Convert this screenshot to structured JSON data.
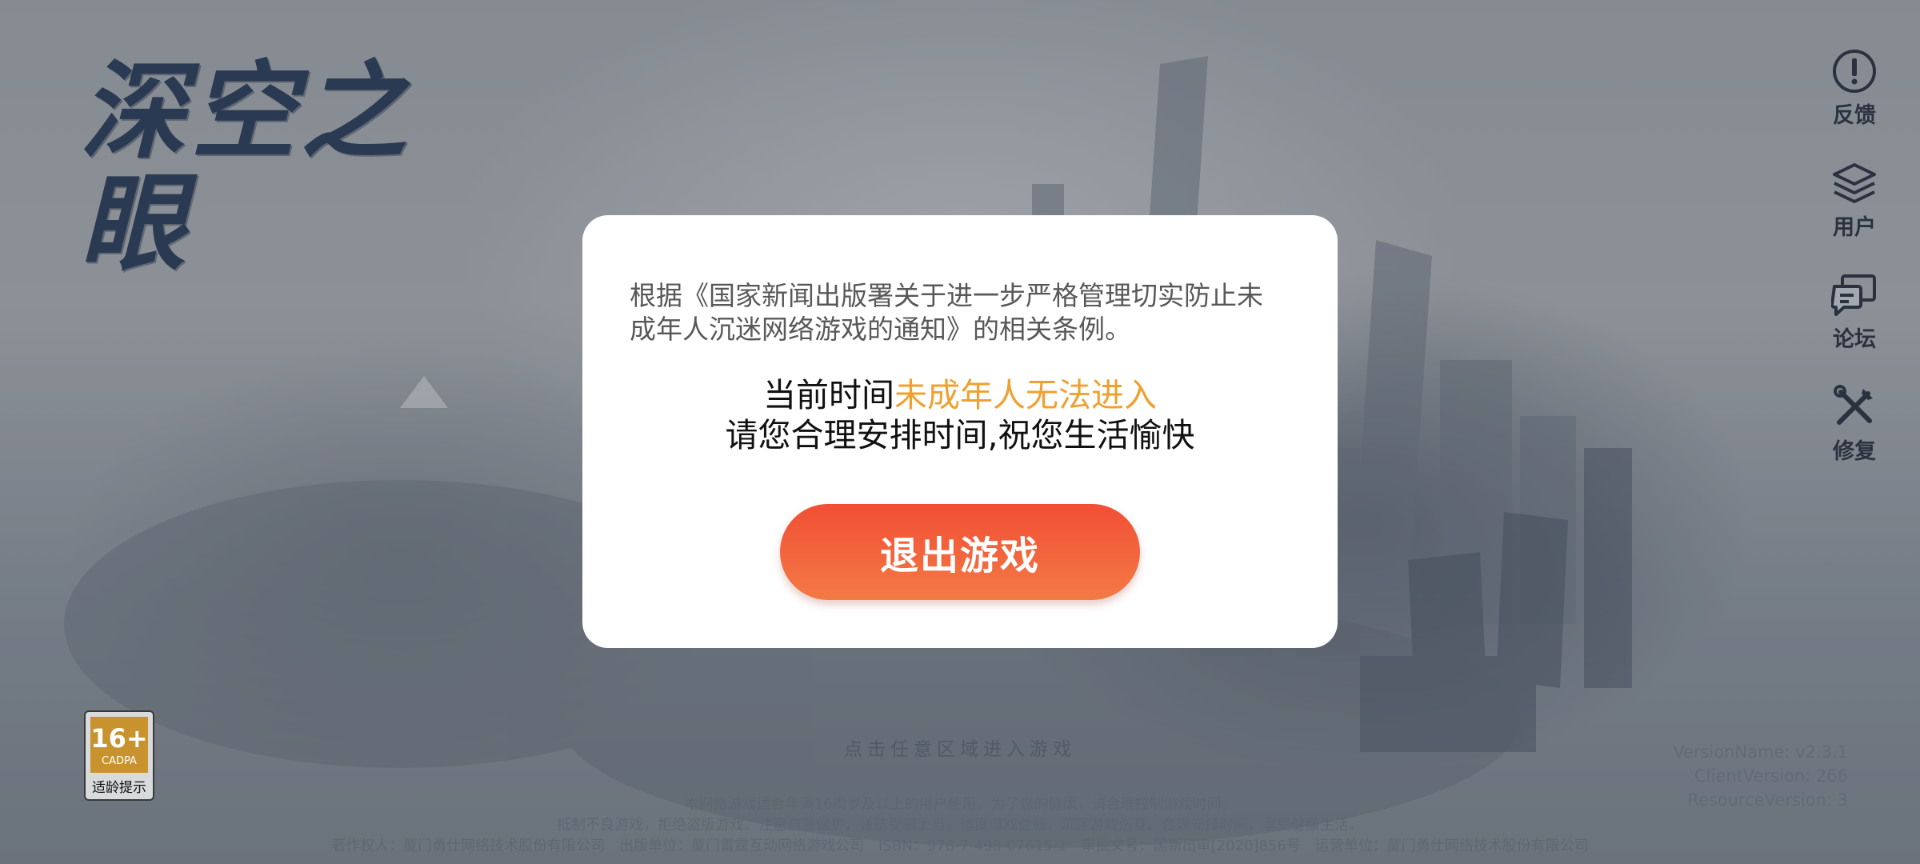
{
  "logo": {
    "text": "深空之眼"
  },
  "side_menu": {
    "items": [
      {
        "label": "反馈",
        "icon": "exclamation-circle-icon"
      },
      {
        "label": "用户",
        "icon": "layers-icon"
      },
      {
        "label": "论坛",
        "icon": "chat-bubbles-icon"
      },
      {
        "label": "修复",
        "icon": "tools-icon"
      }
    ]
  },
  "modal": {
    "notice": "根据《国家新闻出版署关于进一步严格管理切实防止未成年人沉迷网络游戏的通知》的相关条例。",
    "status_prefix": "当前时间",
    "status_highlight": "未成年人无法进入",
    "status_line2": "请您合理安排时间,祝您生活愉快",
    "exit_button": "退出游戏",
    "highlight_color": "#f0a030",
    "button_color": "#f24e35"
  },
  "age_badge": {
    "rating": "16+",
    "org": "CADPA",
    "label": "适龄提示"
  },
  "enter_hint": "点击任意区域进入游戏",
  "footer": {
    "line1": "本网络游戏适合年满16周岁及以上的用户使用。为了您的健康，请合理控制游戏时间。",
    "line2": "抵制不良游戏，拒绝盗版游戏。注意自我保护，谨防受骗上当。适度游戏益脑，沉迷游戏伤身。合理安排时间，享受健康生活。",
    "line3": "著作权人：厦门勇仕网络技术股份有限公司　出版单位：厦门雷霆互动网络游戏公司　ISBN：978-7-498-07615-1　审批文号：国新出审[2020]856号　运营单位：厦门勇仕网络技术股份有限公司"
  },
  "version": {
    "name": "VersionName: v2.3.1",
    "client": "ClientVersion: 266",
    "resource": "ResourceVersion: 3"
  }
}
